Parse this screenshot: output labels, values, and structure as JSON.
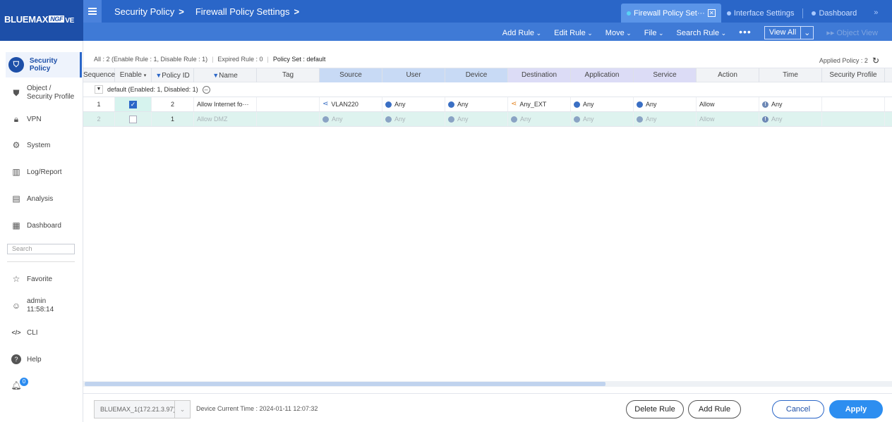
{
  "brand": {
    "name": "BLUEMAX",
    "edition": "NGF",
    "suffix": "VE"
  },
  "breadcrumbs": [
    "Security Policy",
    "Firewall Policy Settings"
  ],
  "tabs": [
    {
      "label": "Firewall Policy Set···",
      "active": true
    },
    {
      "label": "Interface Settings",
      "active": false
    },
    {
      "label": "Dashboard",
      "active": false
    }
  ],
  "tab_more": "»",
  "toolbar": {
    "add_rule": "Add Rule",
    "edit_rule": "Edit Rule",
    "move": "Move",
    "file": "File",
    "search_rule": "Search Rule",
    "more": "•••",
    "view_all": "View All",
    "object_view": "Object View"
  },
  "sidebar": {
    "items": [
      {
        "label": "Security Policy",
        "icon": "shield-icon"
      },
      {
        "label": "Object /",
        "label2": "Security Profile",
        "icon": "shield-half-icon"
      },
      {
        "label": "VPN",
        "icon": "lock-icon"
      },
      {
        "label": "System",
        "icon": "gear-icon"
      },
      {
        "label": "Log/Report",
        "icon": "bar-chart-icon"
      },
      {
        "label": "Analysis",
        "icon": "monitor-chart-icon"
      },
      {
        "label": "Dashboard",
        "icon": "dashboard-icon"
      }
    ],
    "search_placeholder": "Search",
    "favorite": "Favorite",
    "user": "admin",
    "time": "11:58:14",
    "cli": "CLI",
    "help": "Help",
    "notifications": "0"
  },
  "summary": {
    "all": "All : 2 (Enable Rule : 1, Disable Rule : 1)",
    "expired": "Expired Rule : 0",
    "policy_set": "Policy Set : default",
    "applied": "Applied Policy : 2"
  },
  "columns": [
    "Sequence",
    "Enable",
    "Policy ID",
    "Name",
    "Tag",
    "Source",
    "User",
    "Device",
    "Destination",
    "Application",
    "Service",
    "Action",
    "Time",
    "Security Profile"
  ],
  "group": {
    "label": "default (Enabled: 1, Disabled: 1)"
  },
  "rows": [
    {
      "seq": "1",
      "enabled": true,
      "id": "2",
      "name": "Allow Internet fo···",
      "tag": "",
      "source": "VLAN220",
      "user": "Any",
      "device": "Any",
      "destination": "Any_EXT",
      "application": "Any",
      "service": "Any",
      "action": "Allow",
      "time": "Any",
      "profile": ""
    },
    {
      "seq": "2",
      "enabled": false,
      "id": "1",
      "name": "Allow DMZ",
      "tag": "",
      "source": "Any",
      "user": "Any",
      "device": "Any",
      "destination": "Any",
      "application": "Any",
      "service": "Any",
      "action": "Allow",
      "time": "Any",
      "profile": ""
    }
  ],
  "footer": {
    "device": "BLUEMAX_1(172.21.3.97)",
    "device_time": "Device Current Time : 2024-01-11 12:07:32",
    "delete_rule": "Delete Rule",
    "add_rule": "Add Rule",
    "cancel": "Cancel",
    "apply": "Apply"
  }
}
